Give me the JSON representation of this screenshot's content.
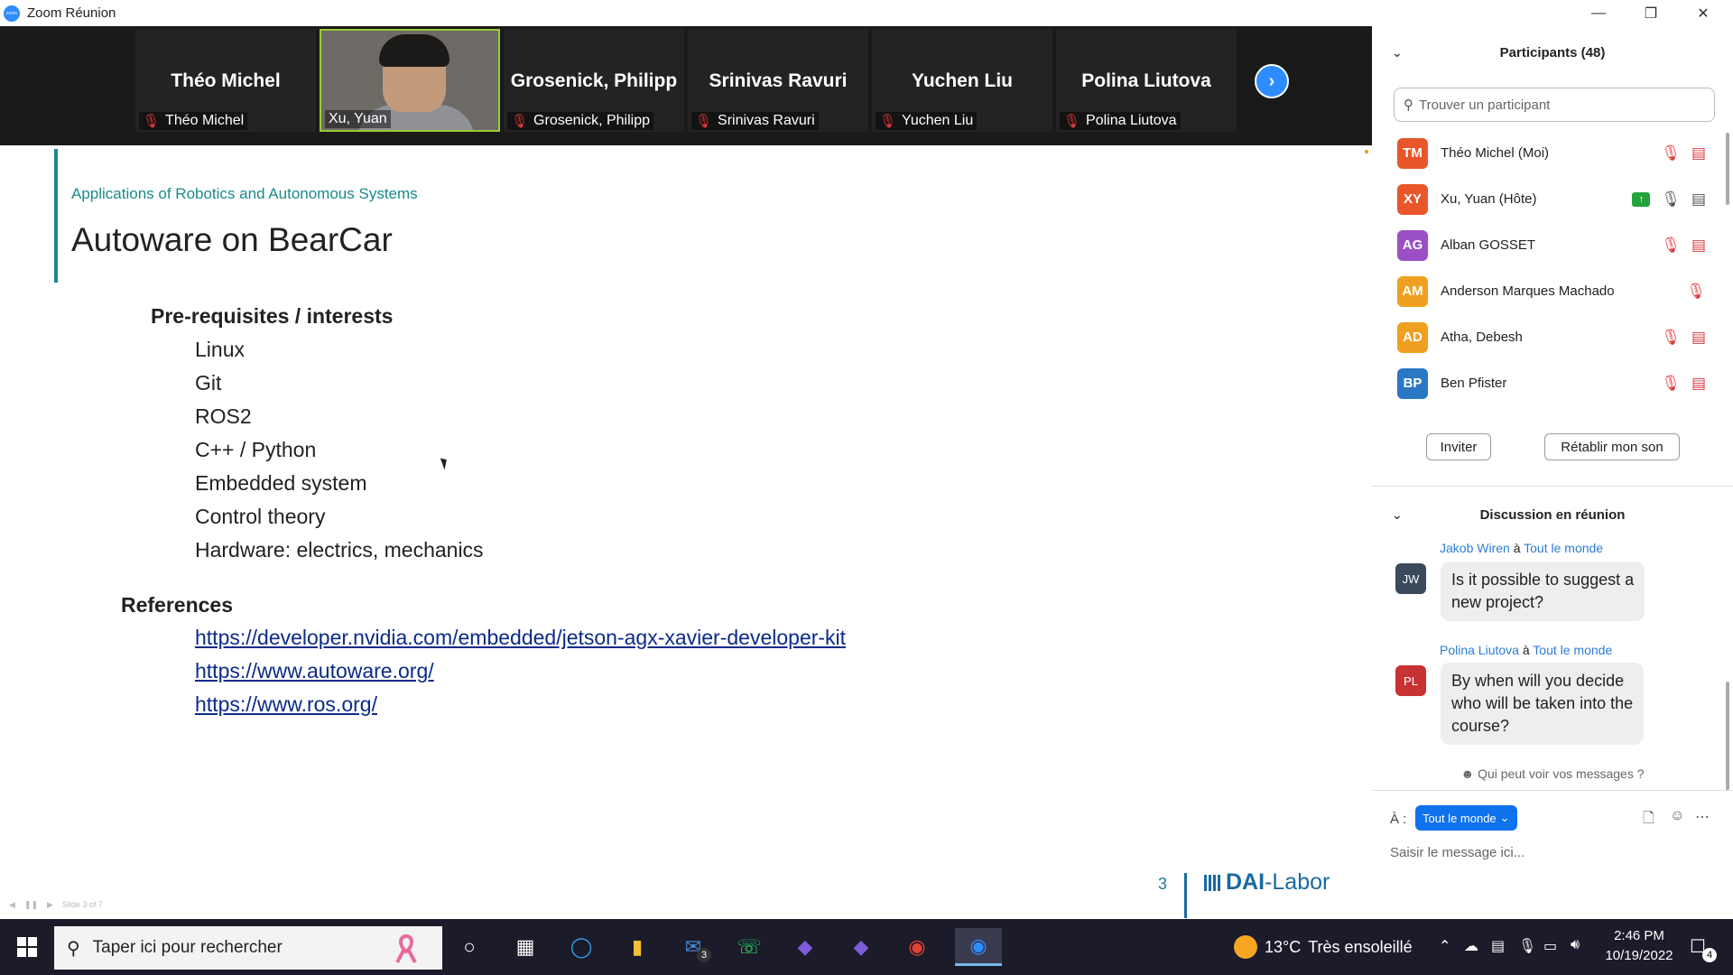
{
  "window": {
    "app_icon_label": "zoom",
    "title": "Zoom Réunion",
    "controls": [
      "minimize-icon",
      "restore-icon",
      "close-icon"
    ]
  },
  "strip": {
    "tiles": [
      {
        "big_name": "Théo Michel",
        "label": "Théo Michel",
        "muted": true,
        "video": false
      },
      {
        "big_name": "",
        "label": "Xu, Yuan",
        "muted": false,
        "video": true
      },
      {
        "big_name": "Grosenick, Philipp",
        "label": "Grosenick, Philipp",
        "muted": true,
        "video": false
      },
      {
        "big_name": "Srinivas Ravuri",
        "label": "Srinivas Ravuri",
        "muted": true,
        "video": false
      },
      {
        "big_name": "Yuchen Liu",
        "label": "Yuchen Liu",
        "muted": true,
        "video": false
      },
      {
        "big_name": "Polina Liutova",
        "label": "Polina Liutova",
        "muted": true,
        "video": false
      }
    ],
    "next_icon": "chevron-right-icon"
  },
  "slide": {
    "subtitle": "Applications of Robotics and Autonomous Systems",
    "title": "Autoware on BearCar",
    "prereq_heading": "Pre-requisites / interests",
    "prereqs": [
      "Linux",
      "Git",
      "ROS2",
      "C++ / Python",
      "Embedded system",
      "Control theory",
      "Hardware: electrics, mechanics"
    ],
    "refs_heading": "References",
    "links": [
      "https://developer.nvidia.com/embedded/jetson-agx-xavier-developer-kit",
      "https://www.autoware.org/",
      "https://www.ros.org/"
    ],
    "page_number": "3",
    "logo_bold": "DAI",
    "logo_rest": "-Labor",
    "controls_label": "Slide 3 of 7"
  },
  "participants_panel": {
    "title": "Participants (48)",
    "search_placeholder": "Trouver un participant",
    "rows": [
      {
        "initials": "TM",
        "name": "Théo Michel (Moi)",
        "color": "#e8562a",
        "mic": "off",
        "cam": "off",
        "sharing": false
      },
      {
        "initials": "XY",
        "name": "Xu, Yuan (Hôte)",
        "color": "#e8562a",
        "mic": "on",
        "cam": "on",
        "sharing": true
      },
      {
        "initials": "AG",
        "name": "Alban GOSSET",
        "color": "#9b4fc4",
        "mic": "off",
        "cam": "off",
        "sharing": false
      },
      {
        "initials": "AM",
        "name": "Anderson Marques Machado",
        "color": "#f0a020",
        "mic": "off",
        "cam": "none",
        "sharing": false
      },
      {
        "initials": "AD",
        "name": "Atha, Debesh",
        "color": "#f0a020",
        "mic": "off",
        "cam": "off",
        "sharing": false
      },
      {
        "initials": "BP",
        "name": "Ben Pfister",
        "color": "#2a78c4",
        "mic": "off",
        "cam": "off",
        "sharing": false
      }
    ],
    "invite_label": "Inviter",
    "unmute_label": "Rétablir mon son"
  },
  "chat_panel": {
    "title": "Discussion en réunion",
    "messages": [
      {
        "sender": "Jakob Wiren",
        "connector": "à",
        "recipient": "Tout le monde",
        "initials": "JW",
        "color": "#3a4a5a",
        "text": [
          "Is it possible to suggest a",
          "new project?"
        ]
      },
      {
        "sender": "Polina Liutova",
        "connector": "à",
        "recipient": "Tout le monde",
        "initials": "PL",
        "color": "#c83232",
        "text": [
          "By when will you decide",
          "who will be taken into the",
          "course?"
        ]
      }
    ],
    "who_can_see": "Qui peut voir vos messages ?",
    "to_label": "À :",
    "to_value": "Tout le monde",
    "input_placeholder": "Saisir le message ici..."
  },
  "taskbar": {
    "search_placeholder": "Taper ici pour rechercher",
    "apps": [
      "cortana-icon",
      "task-view-icon",
      "edge-icon",
      "file-explorer-icon",
      "mail-icon",
      "whatsapp-icon",
      "obsidian-icon",
      "obsidian-icon-2",
      "chrome-icon",
      "zoom-icon"
    ],
    "mail_badge": "3",
    "weather_temp": "13°C",
    "weather_desc": "Très ensoleillé",
    "time": "2:46 PM",
    "date": "10/19/2022",
    "notification_count": "4"
  }
}
